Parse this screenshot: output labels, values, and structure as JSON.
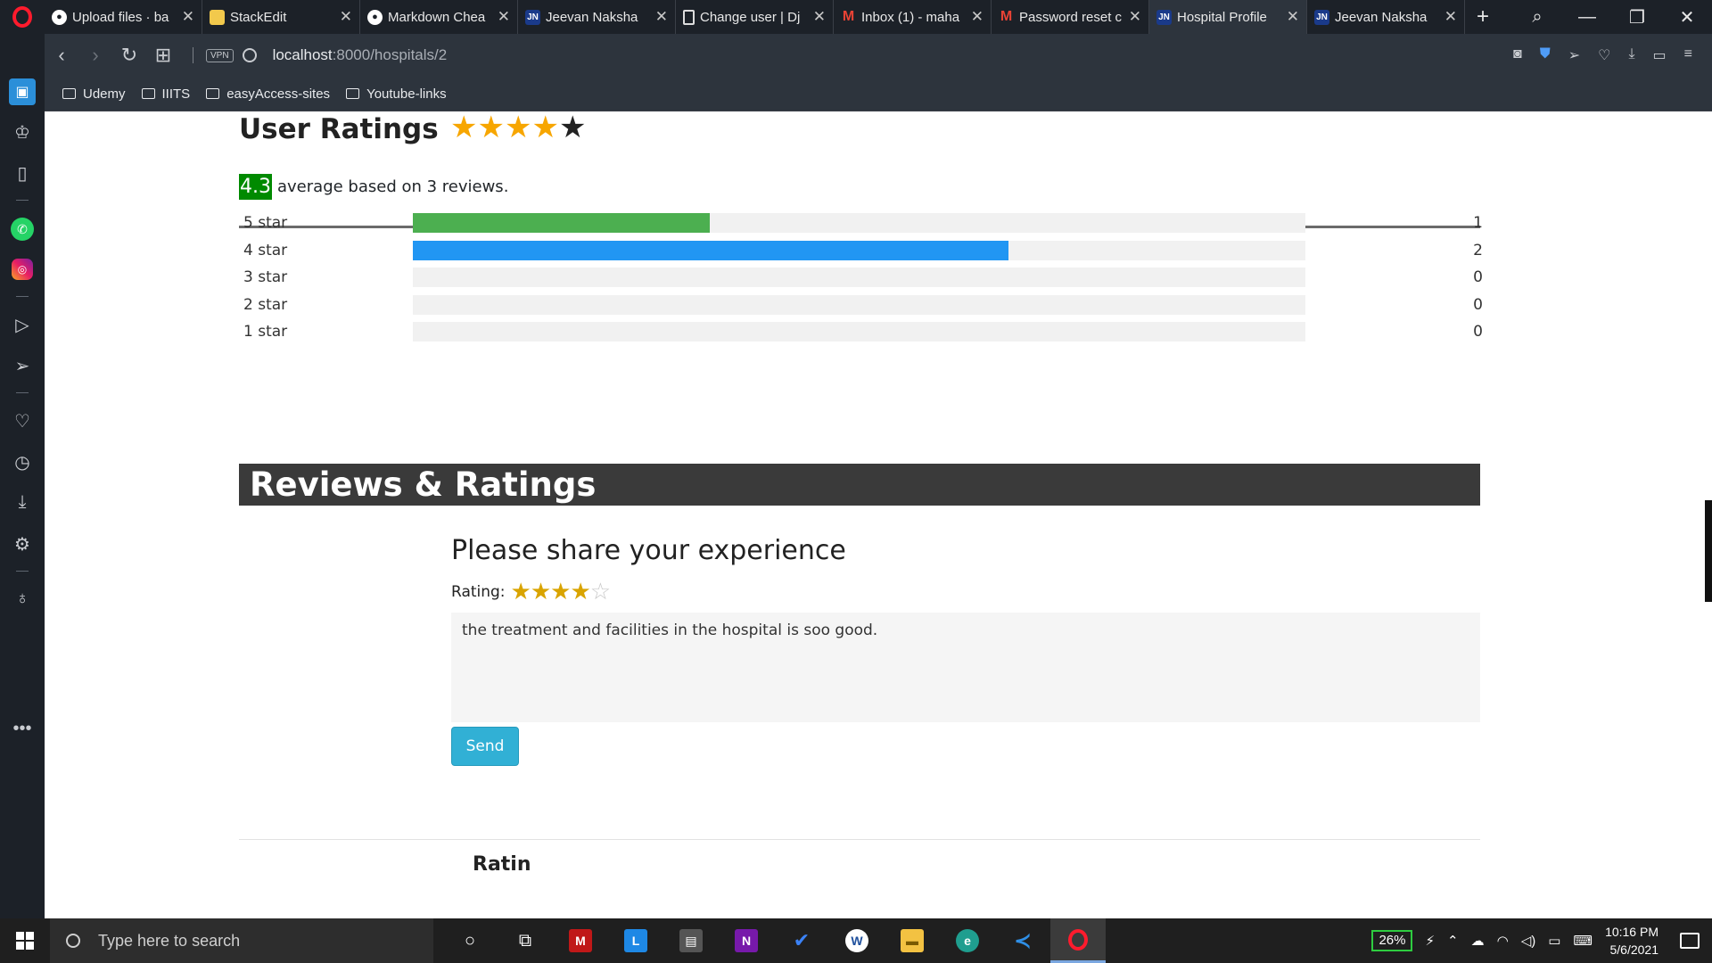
{
  "browser": {
    "tabs": [
      {
        "label": "Upload files · ba",
        "favicon": "github-icon",
        "active": false
      },
      {
        "label": "StackEdit",
        "favicon": "stackedit-icon",
        "active": false
      },
      {
        "label": "Markdown Chea",
        "favicon": "github-icon",
        "active": false
      },
      {
        "label": "Jeevan Naksha",
        "favicon": "jn-icon",
        "active": false
      },
      {
        "label": "Change user | Dj",
        "favicon": "document-icon",
        "active": false
      },
      {
        "label": "Inbox (1) - maha",
        "favicon": "gmail-icon",
        "active": false
      },
      {
        "label": "Password reset c",
        "favicon": "gmail-icon",
        "active": false
      },
      {
        "label": "Hospital Profile",
        "favicon": "jn-icon",
        "active": true
      },
      {
        "label": "Jeevan Naksha",
        "favicon": "jn-icon",
        "active": false
      }
    ],
    "jn_text": "JN",
    "vpn_label": "VPN",
    "url_host": "localhost",
    "url_path": ":8000/hospitals/2",
    "bookmarks": [
      "Udemy",
      "IIITS",
      "easyAccess-sites",
      "Youtube-links"
    ]
  },
  "page": {
    "heading": "User Ratings",
    "heading_stars": {
      "filled": 4,
      "total": 5
    },
    "average_value": "4.3",
    "average_text": "average based on 3 reviews.",
    "breakdown": [
      {
        "label": "5 star",
        "count": "1",
        "fraction": 0.333,
        "color": "#4caf50"
      },
      {
        "label": "4 star",
        "count": "2",
        "fraction": 0.667,
        "color": "#2196f3"
      },
      {
        "label": "3 star",
        "count": "0",
        "fraction": 0,
        "color": "#00bcd4"
      },
      {
        "label": "2 star",
        "count": "0",
        "fraction": 0,
        "color": "#ff9800"
      },
      {
        "label": "1 star",
        "count": "0",
        "fraction": 0,
        "color": "#f44336"
      }
    ],
    "section_title": "Reviews & Ratings",
    "share_title": "Please share your experience",
    "rating_label": "Rating:",
    "rating_selected": 4,
    "rating_total": 5,
    "review_text": "the treatment and facilities in the hospital is soo good.",
    "send_label": "Send",
    "partial_text": "Ratin"
  },
  "taskbar": {
    "search_placeholder": "Type here to search",
    "battery": "26%",
    "time": "10:16 PM",
    "date": "5/6/2021"
  },
  "colors": {
    "average_badge": "#008a00",
    "star_filled": "#f7a600",
    "send_button": "#31b0d5",
    "section_bar": "#3a3a3a"
  }
}
